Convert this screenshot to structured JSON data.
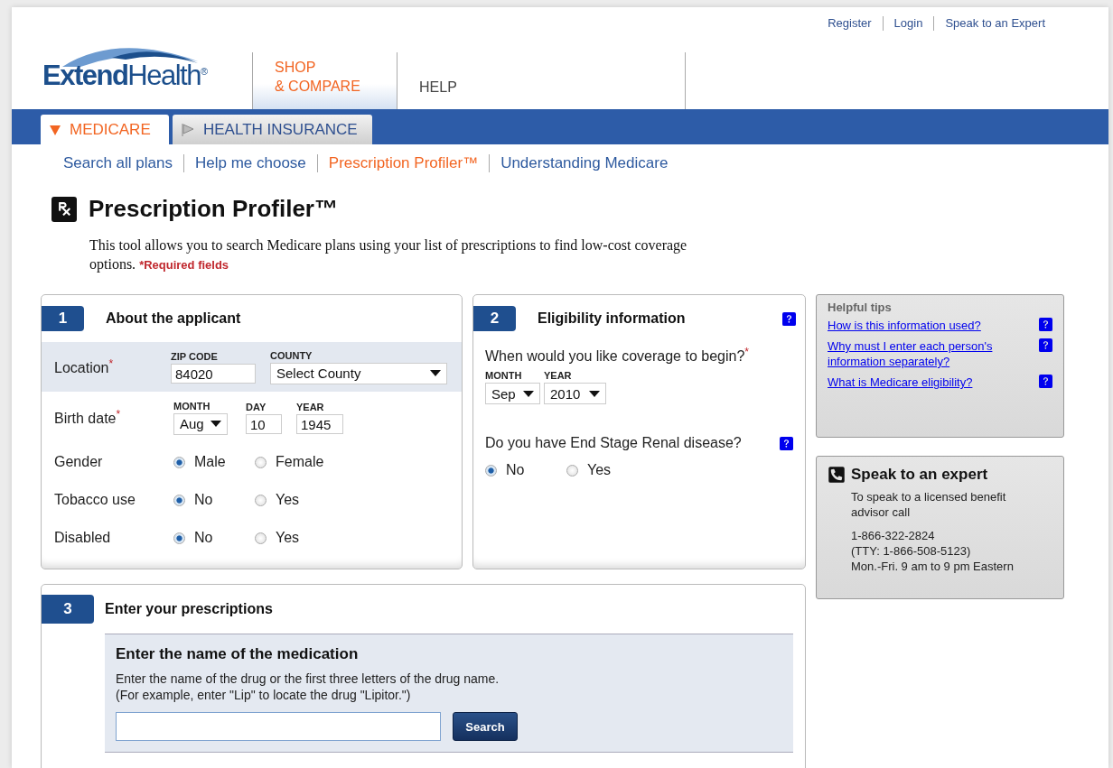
{
  "util_links": [
    "Register",
    "Login",
    "Speak to an Expert"
  ],
  "logo": {
    "name": "**Extend**Health$^{®}$"
  },
  "main_nav": [
    {
      "label": "SHOP\n& COMPARE",
      "selected": true
    },
    {
      "label": "HELP",
      "selected": false
    }
  ],
  "category_tabs": [
    {
      "label": "MEDICARE",
      "selected": true
    },
    {
      "label": "HEALTH INSURANCE",
      "selected": false
    }
  ],
  "sub_nav": [
    {
      "label": "Search all plans",
      "selected": false
    },
    {
      "label": "Help me choose",
      "selected": false
    },
    {
      "label": "Prescription Profiler™",
      "selected": true
    },
    {
      "label": "Understanding Medicare",
      "selected": false
    }
  ],
  "page_title": "Prescription Profiler™",
  "description": "This tool allows you to search Medicare plans using your list of prescriptions to find low-cost coverage options. ***Required fields**",
  "applicant": {
    "number": "1",
    "title": "About the applicant",
    "location": {
      "label": "Location$^{*}$",
      "zip": {
        "label": "ZIP CODE",
        "value": "84020"
      },
      "county": {
        "label": "COUNTY",
        "value": "Select County"
      }
    },
    "birth_date": {
      "label": "Birth date$^{*}$",
      "month": {
        "label": "MONTH",
        "value": "Aug"
      },
      "day": {
        "label": "DAY",
        "value": "10"
      },
      "year": {
        "label": "YEAR",
        "value": "1945"
      }
    },
    "choices": [
      {
        "label": "Gender",
        "options": [
          {
            "label": "Male",
            "selected": true
          },
          {
            "label": "Female",
            "selected": false
          }
        ]
      },
      {
        "label": "Tobacco use",
        "options": [
          {
            "label": "No",
            "selected": true
          },
          {
            "label": "Yes",
            "selected": false
          }
        ]
      },
      {
        "label": "Disabled",
        "options": [
          {
            "label": "No",
            "selected": true
          },
          {
            "label": "Yes",
            "selected": false
          }
        ]
      }
    ]
  },
  "eligibility": {
    "number": "2",
    "title": "Eligibility information",
    "coverage": {
      "question": "When would you like coverage to begin?$^{*}$",
      "month": {
        "label": "MONTH",
        "value": "Sep"
      },
      "year": {
        "label": "YEAR",
        "value": "2010"
      }
    },
    "renal": {
      "question": "Do you have End Stage Renal disease?",
      "options": [
        {
          "label": "No",
          "selected": true
        },
        {
          "label": "Yes",
          "selected": false
        }
      ]
    }
  },
  "tips": {
    "title": "Helpful tips",
    "links": [
      "How is this information used?",
      "Why must I enter each person's information separately?",
      "What is Medicare eligibility?"
    ]
  },
  "expert": {
    "title": "Speak to an expert",
    "text": "To speak to a licensed benefit advisor call",
    "phone": "1-866-322-2824",
    "tty": "(TTY: 1-866-508-5123)",
    "hours": "Mon.-Fri. 9 am to 9 pm Eastern"
  },
  "prescriptions": {
    "number": "3",
    "title": "Enter your prescriptions",
    "heading": "Enter the name of the medication",
    "text": "Enter the name of the drug or the first three letters of the drug name.\n(For example, enter \"Lip\" to locate the drug \"Lipitor.\")",
    "button": "Search"
  }
}
